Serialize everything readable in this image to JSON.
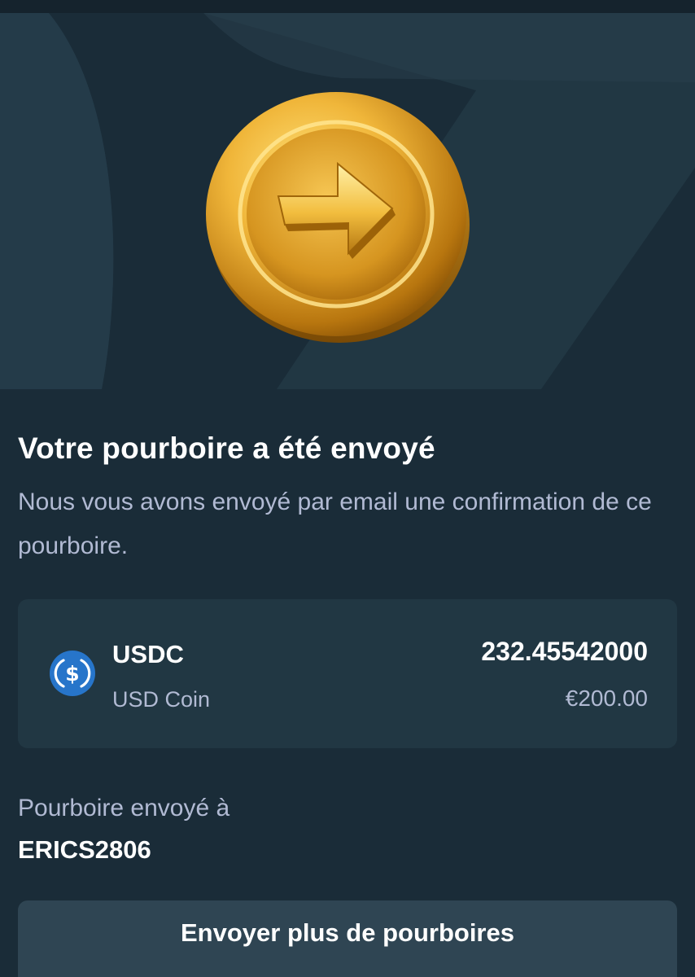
{
  "colors": {
    "background": "#1a2c38",
    "hero_background": "#213743",
    "card_background": "#213743",
    "button_background": "#2f4553",
    "primary_text": "#ffffff",
    "secondary_text": "#b1bad3",
    "usdc_blue": "#2775ca",
    "coin_gold": "#e0a92a"
  },
  "hero": {
    "illustration": "gold-coin-arrow-icon"
  },
  "confirmation": {
    "title": "Votre pourboire a été envoyé",
    "subtitle": "Nous vous avons envoyé par email une confirmation de ce pourboire."
  },
  "currency_card": {
    "icon": "usdc-icon",
    "symbol": "USDC",
    "name": "USD Coin",
    "amount": "232.45542000",
    "fiat_value": "€200.00"
  },
  "recipient": {
    "label": "Pourboire envoyé à",
    "username": "ERICS2806"
  },
  "actions": {
    "send_more_label": "Envoyer plus de pourboires"
  }
}
